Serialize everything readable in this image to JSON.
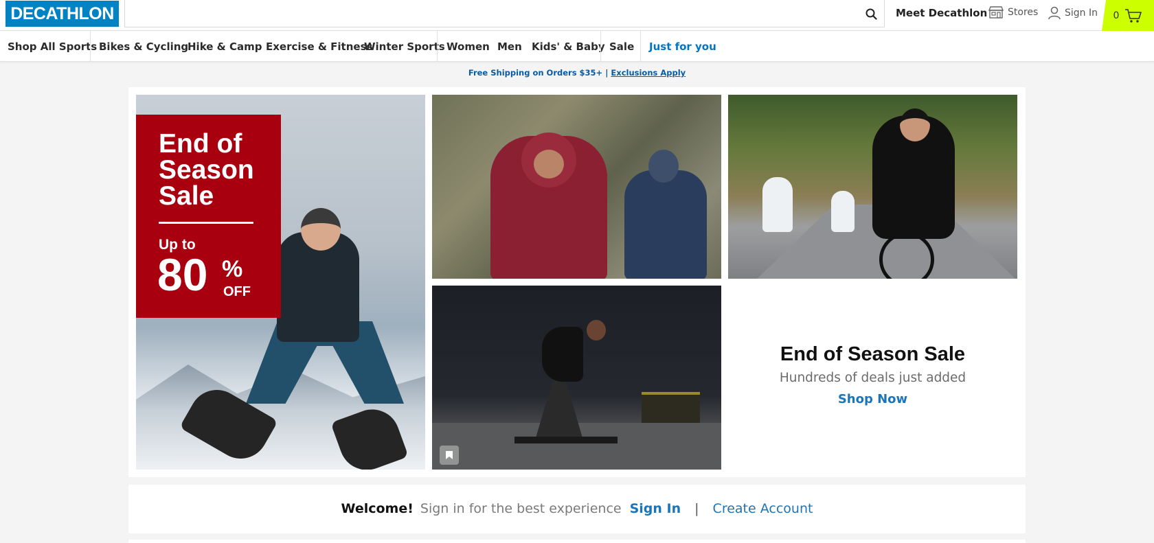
{
  "header": {
    "logo_text": "DECATHLON",
    "search_placeholder": "",
    "meet_label": "Meet Decathlon",
    "stores_label": "Stores",
    "signin_label": "Sign In",
    "cart_count": "0",
    "colors": {
      "brand_blue": "#0082c3",
      "cart_accent": "#ccff00"
    }
  },
  "nav": {
    "items": [
      "Shop All Sports",
      "Bikes & Cycling",
      "Hike & Camp",
      "Exercise & Fitness",
      "Winter Sports",
      "Women",
      "Men",
      "Kids' & Baby",
      "Sale",
      "Just for you"
    ]
  },
  "promo": {
    "text": "Free Shipping on Orders $35+ |",
    "link": "Exclusions Apply"
  },
  "hero": {
    "banner": {
      "title": "End of Season Sale",
      "up_to": "Up to",
      "percent": "80",
      "percent_sign": "%",
      "off": "OFF",
      "accent_color": "#a8000f"
    },
    "panel": {
      "title": "End of Season Sale",
      "subtitle": "Hundreds of deals just added",
      "cta": "Shop Now"
    }
  },
  "welcome": {
    "greeting": "Welcome!",
    "text": "Sign in for the best experience",
    "signin": "Sign In",
    "separator": "|",
    "create": "Create Account"
  }
}
